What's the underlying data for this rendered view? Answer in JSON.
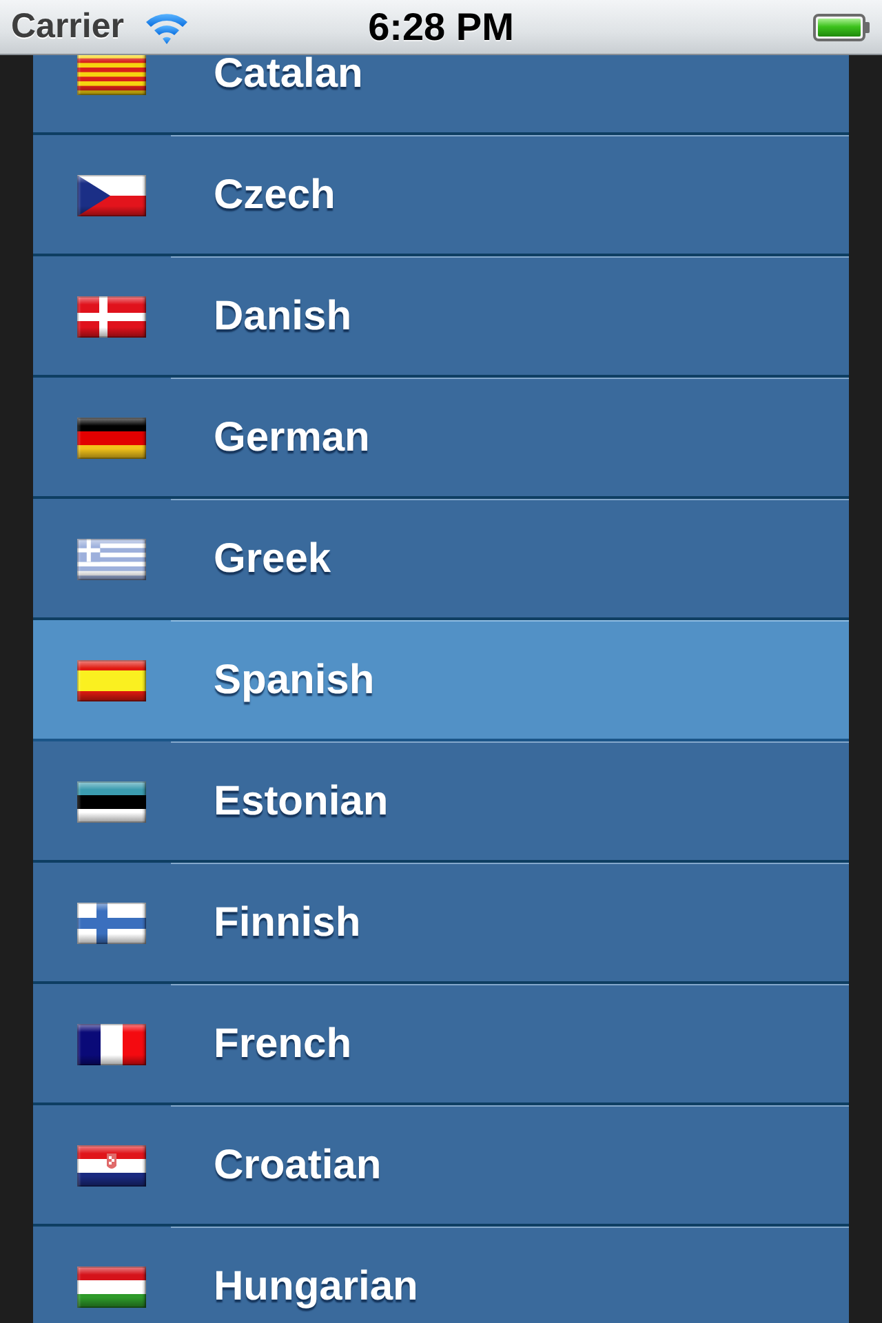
{
  "status_bar": {
    "carrier": "Carrier",
    "time": "6:28 PM"
  },
  "languages": [
    {
      "name": "Catalan",
      "kind": "catalonia",
      "selected": false
    },
    {
      "name": "Czech",
      "kind": "czechia",
      "selected": false
    },
    {
      "name": "Danish",
      "kind": "denmark",
      "selected": false
    },
    {
      "name": "German",
      "kind": "germany",
      "selected": false
    },
    {
      "name": "Greek",
      "kind": "greece",
      "selected": false
    },
    {
      "name": "Spanish",
      "kind": "spain",
      "selected": true
    },
    {
      "name": "Estonian",
      "kind": "estonia",
      "selected": false
    },
    {
      "name": "Finnish",
      "kind": "finland",
      "selected": false
    },
    {
      "name": "French",
      "kind": "france",
      "selected": false
    },
    {
      "name": "Croatian",
      "kind": "croatia",
      "selected": false
    },
    {
      "name": "Hungarian",
      "kind": "hungary",
      "selected": false
    }
  ]
}
